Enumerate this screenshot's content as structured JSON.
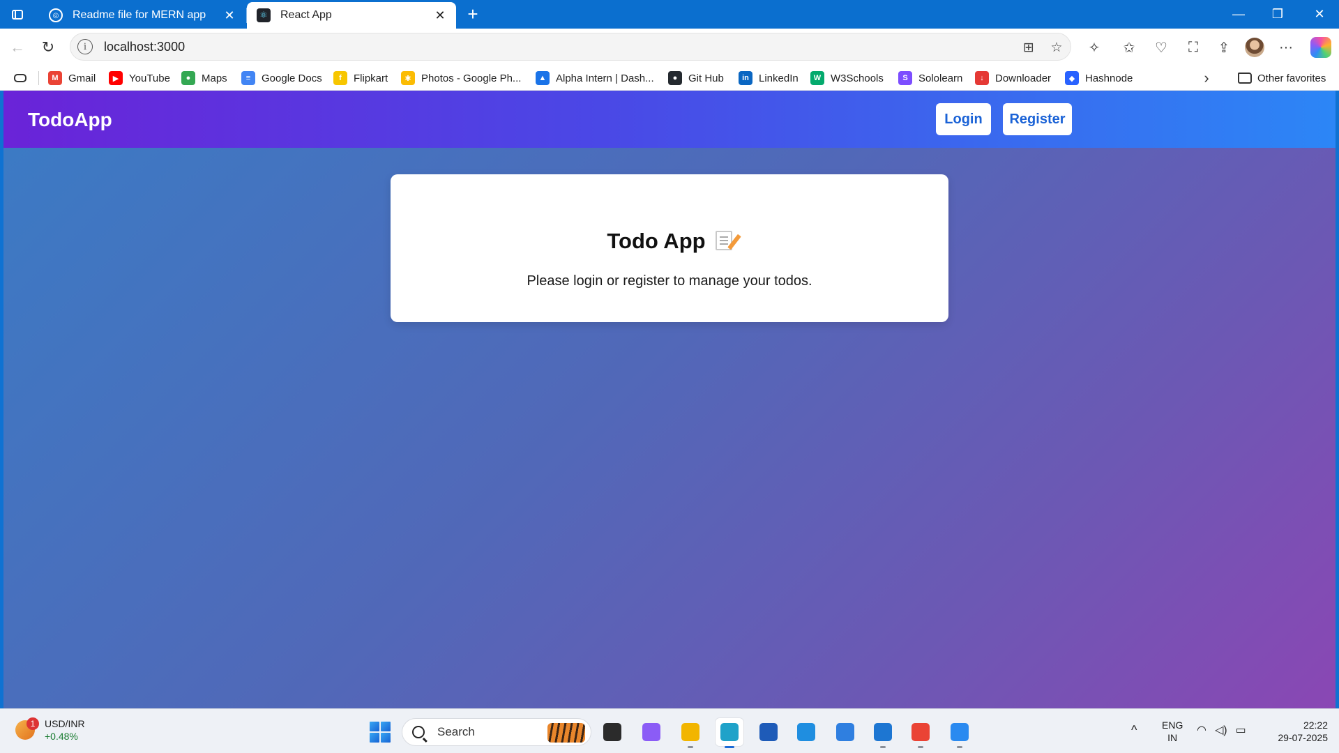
{
  "browser": {
    "tabs": [
      {
        "title": "Readme file for MERN app",
        "icon": "chatgpt-icon",
        "active": false
      },
      {
        "title": "React App",
        "icon": "react-icon",
        "active": true
      }
    ],
    "close_glyph": "✕",
    "new_tab_glyph": "+",
    "window_controls": {
      "minimize": "—",
      "restore": "❐",
      "close": "✕"
    },
    "nav": {
      "back": "←",
      "reload": "↻"
    },
    "address": {
      "url": "localhost:3000",
      "info_glyph": "i"
    },
    "toolbar_glyphs": {
      "app_available": "⊞",
      "favorite": "☆",
      "extensions": "✧",
      "favorites": "✩",
      "health": "♡",
      "screenshot": "⛶",
      "share": "⇪",
      "more": "···"
    }
  },
  "favorites": {
    "items": [
      {
        "label": "Gmail",
        "icon": "gmail-icon",
        "color": "#ea4335",
        "glyph": "M"
      },
      {
        "label": "YouTube",
        "icon": "youtube-icon",
        "color": "#ff0000",
        "glyph": "▶"
      },
      {
        "label": "Maps",
        "icon": "maps-icon",
        "color": "#34a853",
        "glyph": "●"
      },
      {
        "label": "Google Docs",
        "icon": "docs-icon",
        "color": "#4285f4",
        "glyph": "≡"
      },
      {
        "label": "Flipkart",
        "icon": "flipkart-icon",
        "color": "#f7c600",
        "glyph": "f"
      },
      {
        "label": "Photos - Google Ph...",
        "icon": "photos-icon",
        "color": "#fbbc04",
        "glyph": "✱"
      },
      {
        "label": "Alpha Intern | Dash...",
        "icon": "alpha-intern-icon",
        "color": "#1a73e8",
        "glyph": "▲"
      },
      {
        "label": "Git Hub",
        "icon": "github-icon",
        "color": "#24292f",
        "glyph": "●"
      },
      {
        "label": "LinkedIn",
        "icon": "linkedin-icon",
        "color": "#0a66c2",
        "glyph": "in"
      },
      {
        "label": "W3Schools",
        "icon": "w3schools-icon",
        "color": "#04aa6d",
        "glyph": "W"
      },
      {
        "label": "Sololearn",
        "icon": "sololearn-icon",
        "color": "#7c4dff",
        "glyph": "S"
      },
      {
        "label": "Downloader",
        "icon": "downloader-icon",
        "color": "#e53935",
        "glyph": "↓"
      },
      {
        "label": "Hashnode",
        "icon": "hashnode-icon",
        "color": "#2962ff",
        "glyph": "◆"
      }
    ],
    "more_glyph": "›",
    "other": "Other favorites"
  },
  "app": {
    "brand": "TodoApp",
    "login": "Login",
    "register": "Register",
    "card_title": "Todo App",
    "card_text": "Please login or register to manage your todos.",
    "colors": {
      "nav_start": "#6a23d8",
      "nav_end": "#2c86f6",
      "button_text": "#1a62d6"
    }
  },
  "taskbar": {
    "widget": {
      "title": "USD/INR",
      "value": "+0.48%",
      "badge": "1"
    },
    "search_placeholder": "Search",
    "apps": [
      {
        "name": "task-view-icon",
        "color": "#2b2b2b",
        "running": false,
        "active": false
      },
      {
        "name": "copilot-icon",
        "color": "#8b5cf6",
        "running": false,
        "active": false
      },
      {
        "name": "file-explorer-icon",
        "color": "#f2b500",
        "running": true,
        "active": false
      },
      {
        "name": "edge-icon",
        "color": "#1fa2c9",
        "running": true,
        "active": true
      },
      {
        "name": "microsoft-store-icon",
        "color": "#1e5bb8",
        "running": false,
        "active": false
      },
      {
        "name": "myhp-icon",
        "color": "#1f8ee0",
        "running": false,
        "active": false
      },
      {
        "name": "get-help-icon",
        "color": "#2f7fe0",
        "running": false,
        "active": false
      },
      {
        "name": "vscode-icon",
        "color": "#1d76d2",
        "running": true,
        "active": false
      },
      {
        "name": "chrome-icon",
        "color": "#ea4335",
        "running": true,
        "active": false
      },
      {
        "name": "photos-app-icon",
        "color": "#2a8af0",
        "running": true,
        "active": false
      }
    ],
    "tray_chevron": "^",
    "language": {
      "line1": "ENG",
      "line2": "IN"
    },
    "tray_glyphs": {
      "wifi": "◠",
      "volume": "◁)",
      "battery": "▭"
    },
    "clock": {
      "time": "22:22",
      "date": "29-07-2025"
    }
  }
}
